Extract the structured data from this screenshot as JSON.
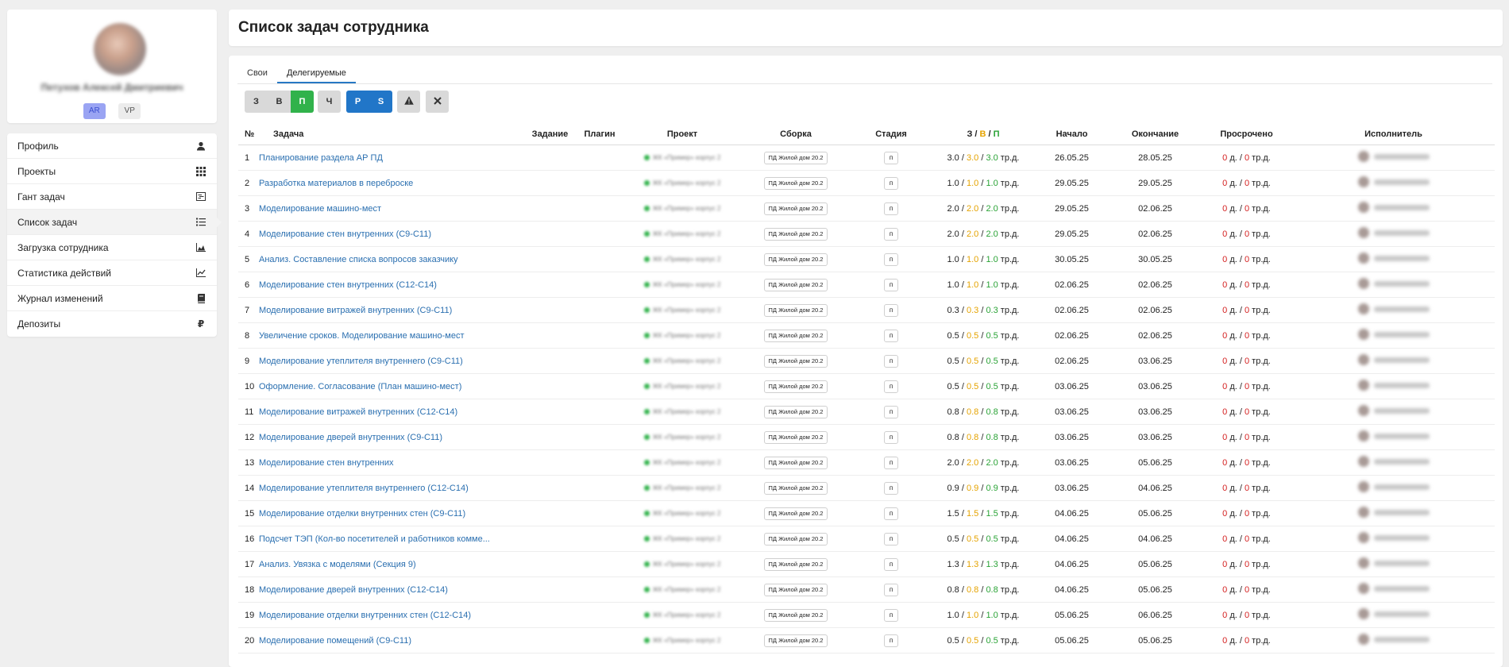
{
  "sidebar": {
    "profile": {
      "name": "Петухов Алексей Дмитриевич",
      "roles": [
        {
          "label": "AR",
          "active": true
        },
        {
          "label": "VP",
          "active": false
        }
      ]
    },
    "menu": [
      {
        "label": "Профиль",
        "icon": "user-icon"
      },
      {
        "label": "Проекты",
        "icon": "grid-icon"
      },
      {
        "label": "Гант задач",
        "icon": "gantt-icon"
      },
      {
        "label": "Список задач",
        "icon": "list-icon",
        "active": true
      },
      {
        "label": "Загрузка сотрудника",
        "icon": "area-chart-icon"
      },
      {
        "label": "Статистика действий",
        "icon": "line-chart-icon"
      },
      {
        "label": "Журнал изменений",
        "icon": "book-icon"
      },
      {
        "label": "Депозиты",
        "icon": "ruble-icon"
      }
    ]
  },
  "header": {
    "title": "Список задач сотрудника"
  },
  "tabs": [
    {
      "label": "Свои",
      "active": false
    },
    {
      "label": "Делегируемые",
      "active": true
    }
  ],
  "filters": {
    "status": [
      "З",
      "В",
      "П"
    ],
    "ch": "Ч",
    "type": [
      "Р",
      "S"
    ],
    "warning_icon": "warning-icon",
    "clear_icon": "close-icon"
  },
  "table": {
    "columns": {
      "num": "№",
      "task": "Задача",
      "assignment": "Задание",
      "plugin": "Плагин",
      "project": "Проект",
      "build": "Сборка",
      "stage": "Стадия",
      "effort_a": "З",
      "effort_b": "В",
      "effort_c": "П",
      "start": "Начало",
      "end": "Окончание",
      "overdue": "Просрочено",
      "executor": "Исполнитель"
    },
    "build_label": "ПД Жилой дом 20.2",
    "stage_label": "п",
    "project_label": "ЖК «Пример» корпус 2",
    "unit_effort": "тр.д.",
    "unit_days": "д.",
    "rows": [
      {
        "n": "1",
        "task": "Планирование раздела АР ПД",
        "a": "3.0",
        "b": "3.0",
        "c": "3.0",
        "start": "26.05.25",
        "end": "28.05.25",
        "od1": "0",
        "od2": "0"
      },
      {
        "n": "2",
        "task": "Разработка материалов в переброске",
        "a": "1.0",
        "b": "1.0",
        "c": "1.0",
        "start": "29.05.25",
        "end": "29.05.25",
        "od1": "0",
        "od2": "0"
      },
      {
        "n": "3",
        "task": "Моделирование машино-мест",
        "a": "2.0",
        "b": "2.0",
        "c": "2.0",
        "start": "29.05.25",
        "end": "02.06.25",
        "od1": "0",
        "od2": "0"
      },
      {
        "n": "4",
        "task": "Моделирование стен внутренних (С9-С11)",
        "a": "2.0",
        "b": "2.0",
        "c": "2.0",
        "start": "29.05.25",
        "end": "02.06.25",
        "od1": "0",
        "od2": "0"
      },
      {
        "n": "5",
        "task": "Анализ. Составление списка вопросов заказчику",
        "a": "1.0",
        "b": "1.0",
        "c": "1.0",
        "start": "30.05.25",
        "end": "30.05.25",
        "od1": "0",
        "od2": "0"
      },
      {
        "n": "6",
        "task": "Моделирование стен внутренних (С12-С14)",
        "a": "1.0",
        "b": "1.0",
        "c": "1.0",
        "start": "02.06.25",
        "end": "02.06.25",
        "od1": "0",
        "od2": "0"
      },
      {
        "n": "7",
        "task": "Моделирование витражей внутренних (С9-С11)",
        "a": "0.3",
        "b": "0.3",
        "c": "0.3",
        "start": "02.06.25",
        "end": "02.06.25",
        "od1": "0",
        "od2": "0"
      },
      {
        "n": "8",
        "task": "Увеличение сроков. Моделирование машино-мест",
        "a": "0.5",
        "b": "0.5",
        "c": "0.5",
        "start": "02.06.25",
        "end": "02.06.25",
        "od1": "0",
        "od2": "0"
      },
      {
        "n": "9",
        "task": "Моделирование утеплителя внутреннего (С9-С11)",
        "a": "0.5",
        "b": "0.5",
        "c": "0.5",
        "start": "02.06.25",
        "end": "03.06.25",
        "od1": "0",
        "od2": "0"
      },
      {
        "n": "10",
        "task": "Оформление. Согласование (План машино-мест)",
        "a": "0.5",
        "b": "0.5",
        "c": "0.5",
        "start": "03.06.25",
        "end": "03.06.25",
        "od1": "0",
        "od2": "0"
      },
      {
        "n": "11",
        "task": "Моделирование витражей внутренних (С12-С14)",
        "a": "0.8",
        "b": "0.8",
        "c": "0.8",
        "start": "03.06.25",
        "end": "03.06.25",
        "od1": "0",
        "od2": "0"
      },
      {
        "n": "12",
        "task": "Моделирование дверей внутренних (С9-С11)",
        "a": "0.8",
        "b": "0.8",
        "c": "0.8",
        "start": "03.06.25",
        "end": "03.06.25",
        "od1": "0",
        "od2": "0"
      },
      {
        "n": "13",
        "task": "Моделирование стен внутренних",
        "a": "2.0",
        "b": "2.0",
        "c": "2.0",
        "start": "03.06.25",
        "end": "05.06.25",
        "od1": "0",
        "od2": "0"
      },
      {
        "n": "14",
        "task": "Моделирование утеплителя внутреннего (С12-С14)",
        "a": "0.9",
        "b": "0.9",
        "c": "0.9",
        "start": "03.06.25",
        "end": "04.06.25",
        "od1": "0",
        "od2": "0"
      },
      {
        "n": "15",
        "task": "Моделирование отделки внутренних стен (С9-С11)",
        "a": "1.5",
        "b": "1.5",
        "c": "1.5",
        "start": "04.06.25",
        "end": "05.06.25",
        "od1": "0",
        "od2": "0"
      },
      {
        "n": "16",
        "task": "Подсчет ТЭП (Кол-во посетителей и работников комме...",
        "a": "0.5",
        "b": "0.5",
        "c": "0.5",
        "start": "04.06.25",
        "end": "04.06.25",
        "od1": "0",
        "od2": "0"
      },
      {
        "n": "17",
        "task": "Анализ. Увязка с моделями (Секция 9)",
        "a": "1.3",
        "b": "1.3",
        "c": "1.3",
        "start": "04.06.25",
        "end": "05.06.25",
        "od1": "0",
        "od2": "0"
      },
      {
        "n": "18",
        "task": "Моделирование дверей внутренних (С12-С14)",
        "a": "0.8",
        "b": "0.8",
        "c": "0.8",
        "start": "04.06.25",
        "end": "05.06.25",
        "od1": "0",
        "od2": "0"
      },
      {
        "n": "19",
        "task": "Моделирование отделки внутренних стен (С12-С14)",
        "a": "1.0",
        "b": "1.0",
        "c": "1.0",
        "start": "05.06.25",
        "end": "06.06.25",
        "od1": "0",
        "od2": "0"
      },
      {
        "n": "20",
        "task": "Моделирование помещений (С9-С11)",
        "a": "0.5",
        "b": "0.5",
        "c": "0.5",
        "start": "05.06.25",
        "end": "05.06.25",
        "od1": "0",
        "od2": "0"
      }
    ]
  }
}
